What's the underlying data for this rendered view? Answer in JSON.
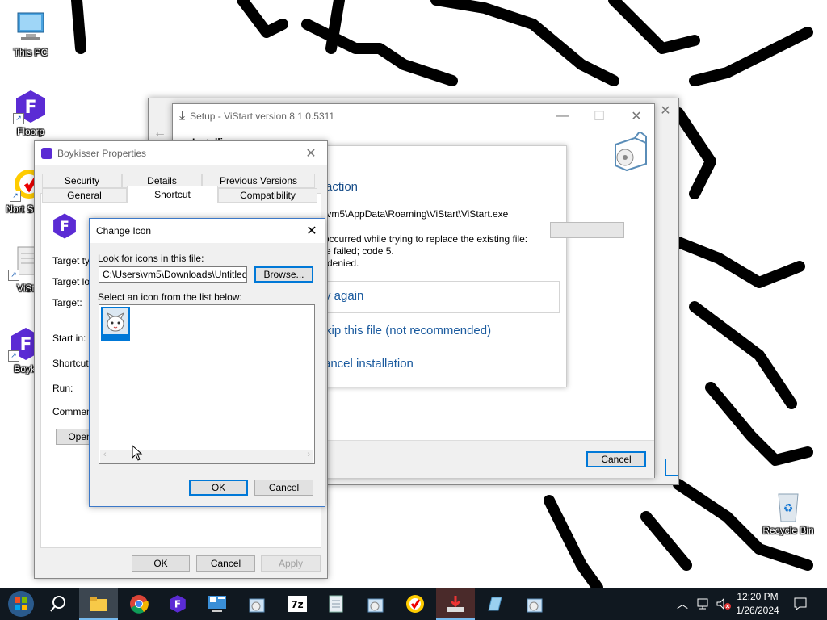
{
  "desktop": {
    "icons": [
      {
        "label": "This PC",
        "icon": "computer-icon"
      },
      {
        "label": "Floorp",
        "icon": "floorp-icon"
      },
      {
        "label": "Nort Secu",
        "icon": "norton-security-icon"
      },
      {
        "label": "ViSt",
        "icon": "vistart-file-icon"
      },
      {
        "label": "Boyki",
        "icon": "boykisser-icon"
      },
      {
        "label": "Recycle Bin",
        "icon": "recycle-bin-icon"
      }
    ]
  },
  "setup": {
    "title": "Setup - ViStart version 8.1.0.5311",
    "partial_heading": "Installing",
    "error_heading": "action",
    "file_path": "\\vm5\\AppData\\Roaming\\ViStart\\ViStart.exe",
    "error_line1": "occurred while trying to replace the existing file:",
    "error_line2": "e failed; code 5.",
    "error_line3": "denied.",
    "option_retry": "y again",
    "option_skip": "kip this file (not recommended)",
    "option_cancel": "ancel installation",
    "cancel_label": "Cancel"
  },
  "properties": {
    "title": "Boykisser Properties",
    "tabs_back": [
      "Security",
      "Details",
      "Previous Versions"
    ],
    "tabs_front": [
      "General",
      "Shortcut",
      "Compatibility"
    ],
    "selected_tab": "Shortcut",
    "fields": [
      "Target typ",
      "Target loc",
      "Target:",
      "Start in:",
      "Shortcut k",
      "Run:",
      "Comment:"
    ],
    "open_label": "Open",
    "ok_label": "OK",
    "cancel_label": "Cancel",
    "apply_label": "Apply"
  },
  "change_icon": {
    "title": "Change Icon",
    "look_label": "Look for icons in this file:",
    "file_value": "C:\\Users\\vm5\\Downloads\\Untitled.ico",
    "browse_label": "Browse...",
    "list_label": "Select an icon from the list below:",
    "ok_label": "OK",
    "cancel_label": "Cancel"
  },
  "taskbar": {
    "apps": [
      "start-icon",
      "search-icon",
      "file-explorer-icon",
      "chrome-icon",
      "floorp-icon",
      "control-panel-icon",
      "setup-icon",
      "7zip-icon",
      "notepad-icon",
      "setup-icon",
      "norton-icon",
      "installer-icon",
      "pen-icon",
      "setup-icon"
    ],
    "time": "12:20 PM",
    "date": "1/26/2024"
  }
}
